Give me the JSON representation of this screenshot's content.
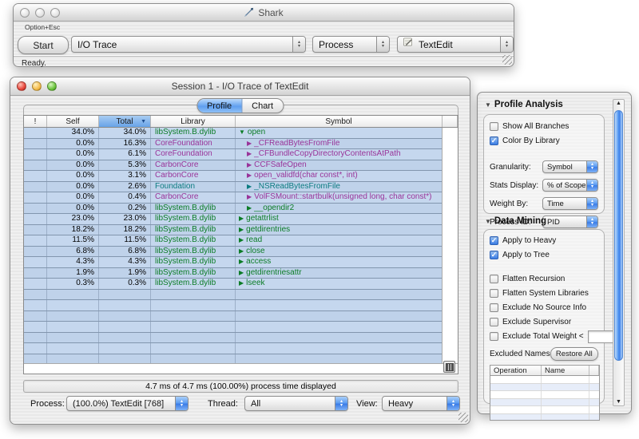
{
  "shark_window": {
    "title": "Shark",
    "shortcut_hint": "Option+Esc",
    "start_button_label": "Start",
    "config_popup_value": "I/O Trace",
    "target_popup_value": "Process",
    "process_popup_value": "TextEdit",
    "status_text": "Ready."
  },
  "session_window": {
    "title": "Session 1 - I/O Trace of TextEdit",
    "tabs": [
      {
        "label": "Profile",
        "selected": true
      },
      {
        "label": "Chart",
        "selected": false
      }
    ],
    "table": {
      "headers": [
        "!",
        "Self",
        "Total",
        "Library",
        "Symbol"
      ],
      "sorted_column": "Total",
      "sort_direction": "desc",
      "rows": [
        {
          "self": "34.0%",
          "total": "34.0%",
          "library": "libSystem.B.dylib",
          "symbol": "open",
          "disclosure": "expanded",
          "indent": 0
        },
        {
          "self": "0.0%",
          "total": "16.3%",
          "library": "CoreFoundation",
          "symbol": "_CFReadBytesFromFile",
          "disclosure": "collapsed",
          "indent": 1
        },
        {
          "self": "0.0%",
          "total": "6.1%",
          "library": "CoreFoundation",
          "symbol": "_CFBundleCopyDirectoryContentsAtPath",
          "disclosure": "collapsed",
          "indent": 1
        },
        {
          "self": "0.0%",
          "total": "5.3%",
          "library": "CarbonCore",
          "symbol": "CCFSafeOpen",
          "disclosure": "collapsed",
          "indent": 1
        },
        {
          "self": "0.0%",
          "total": "3.1%",
          "library": "CarbonCore",
          "symbol": "open_validfd(char const*, int)",
          "disclosure": "collapsed",
          "indent": 1
        },
        {
          "self": "0.0%",
          "total": "2.6%",
          "library": "Foundation",
          "symbol": "_NSReadBytesFromFile",
          "disclosure": "collapsed",
          "indent": 1
        },
        {
          "self": "0.0%",
          "total": "0.4%",
          "library": "CarbonCore",
          "symbol": "VolFSMount::startbulk(unsigned long, char const*)",
          "disclosure": "collapsed",
          "indent": 1
        },
        {
          "self": "0.0%",
          "total": "0.2%",
          "library": "libSystem.B.dylib",
          "symbol": "__opendir2",
          "disclosure": "collapsed",
          "indent": 1
        },
        {
          "self": "23.0%",
          "total": "23.0%",
          "library": "libSystem.B.dylib",
          "symbol": "getattrlist",
          "disclosure": "collapsed",
          "indent": 0
        },
        {
          "self": "18.2%",
          "total": "18.2%",
          "library": "libSystem.B.dylib",
          "symbol": "getdirentries",
          "disclosure": "collapsed",
          "indent": 0
        },
        {
          "self": "11.5%",
          "total": "11.5%",
          "library": "libSystem.B.dylib",
          "symbol": "read",
          "disclosure": "collapsed",
          "indent": 0
        },
        {
          "self": "6.8%",
          "total": "6.8%",
          "library": "libSystem.B.dylib",
          "symbol": "close",
          "disclosure": "collapsed",
          "indent": 0
        },
        {
          "self": "4.3%",
          "total": "4.3%",
          "library": "libSystem.B.dylib",
          "symbol": "access",
          "disclosure": "collapsed",
          "indent": 0
        },
        {
          "self": "1.9%",
          "total": "1.9%",
          "library": "libSystem.B.dylib",
          "symbol": "getdirentriesattr",
          "disclosure": "collapsed",
          "indent": 0
        },
        {
          "self": "0.3%",
          "total": "0.3%",
          "library": "libSystem.B.dylib",
          "symbol": "lseek",
          "disclosure": "collapsed",
          "indent": 0
        }
      ],
      "empty_row_count": 7
    },
    "library_colors": {
      "libSystem.B.dylib": "#0b7c26",
      "CoreFoundation": "#993399",
      "CarbonCore": "#993399",
      "Foundation": "#0b7b80"
    },
    "summary_text": "4.7 ms of 4.7 ms (100.00%) process time displayed",
    "footer": {
      "process_label": "Process:",
      "process_value": "(100.0%) TextEdit [768]",
      "thread_label": "Thread:",
      "thread_value": "All",
      "view_label": "View:",
      "view_value": "Heavy"
    }
  },
  "drawer": {
    "profile_analysis": {
      "title": "Profile Analysis",
      "checkboxes": [
        {
          "label": "Show All Branches",
          "checked": false
        },
        {
          "label": "Color By Library",
          "checked": true
        }
      ],
      "popups": [
        {
          "label": "Granularity:",
          "value": "Symbol"
        },
        {
          "label": "Stats Display:",
          "value": "% of Scope"
        },
        {
          "label": "Weight By:",
          "value": "Time"
        },
        {
          "label": "Process ID:",
          "value": "PID"
        }
      ]
    },
    "data_mining": {
      "title": "Data Mining",
      "apply_checkboxes": [
        {
          "label": "Apply to Heavy",
          "checked": true
        },
        {
          "label": "Apply to Tree",
          "checked": true
        }
      ],
      "filter_checkboxes": [
        {
          "label": "Flatten Recursion",
          "checked": false
        },
        {
          "label": "Flatten System Libraries",
          "checked": false
        },
        {
          "label": "Exclude No Source Info",
          "checked": false
        },
        {
          "label": "Exclude Supervisor",
          "checked": false
        },
        {
          "label": "Exclude Total Weight <",
          "checked": false,
          "has_input": true,
          "input_value": ""
        }
      ],
      "excluded_names_label": "Excluded Names",
      "restore_all_label": "Restore All",
      "excluded_table_headers": [
        "Operation",
        "Name"
      ],
      "excluded_table_empty_rows": 6
    }
  }
}
